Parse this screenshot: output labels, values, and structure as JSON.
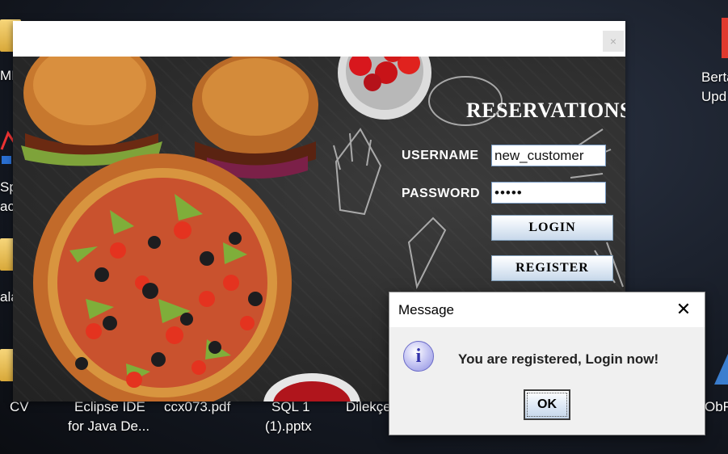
{
  "desktop": {
    "icons": [
      {
        "label": "MIS"
      },
      {
        "label": "Sp"
      },
      {
        "label": "ac"
      },
      {
        "label": "ala"
      },
      {
        "label": "CV"
      },
      {
        "label": "Eclipse IDE"
      },
      {
        "label": "for Java De..."
      },
      {
        "label": "ccx073.pdf"
      },
      {
        "label": "SQL 1"
      },
      {
        "label": "(1).pptx"
      },
      {
        "label": "Dilekçe"
      },
      {
        "label": "Berta"
      },
      {
        "label": "Upd"
      },
      {
        "label": "ObFr"
      }
    ]
  },
  "app": {
    "close_glyph": "×",
    "title": "RESERVATIONS",
    "username_label": "USERNAME",
    "username_value": "new_customer",
    "password_label": "PASSWORD",
    "password_value": "•••••",
    "login_label": "LOGIN",
    "register_label": "REGISTER"
  },
  "dialog": {
    "title": "Message",
    "close_glyph": "✕",
    "icon": "info-icon",
    "icon_glyph": "i",
    "message": "You are registered, Login now!",
    "ok_label": "OK"
  },
  "colors": {
    "button_border": "#7f9db9",
    "input_border": "#7a9cc4",
    "info_icon": "#8e8fe0"
  }
}
